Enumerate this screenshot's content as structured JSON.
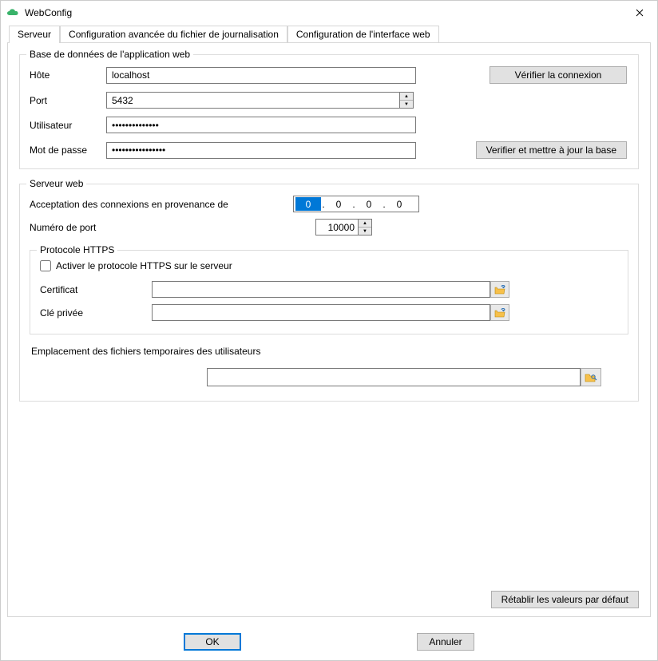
{
  "window": {
    "title": "WebConfig"
  },
  "tabs": {
    "server": "Serveur",
    "logging": "Configuration avancée du fichier de journalisation",
    "webui": "Configuration de l'interface web"
  },
  "db": {
    "legend": "Base de données de l'application web",
    "host_label": "Hôte",
    "host_value": "localhost",
    "port_label": "Port",
    "port_value": "5432",
    "user_label": "Utilisateur",
    "user_value": "••••••••••••••",
    "password_label": "Mot de passe",
    "password_value": "••••••••••••••••",
    "verify_connection": "Vérifier la connexion",
    "verify_update_db": "Verifier et mettre à jour la base"
  },
  "webserver": {
    "legend": "Serveur web",
    "accept_label": "Acceptation des connexions en provenance de",
    "ip_octets": [
      "0",
      "0",
      "0",
      "0"
    ],
    "port_label": "Numéro de port",
    "port_value": "10000"
  },
  "https": {
    "legend": "Protocole HTTPS",
    "enable_label": "Activer le protocole HTTPS sur le serveur",
    "enabled": false,
    "cert_label": "Certificat",
    "cert_value": "",
    "key_label": "Clé privée",
    "key_value": ""
  },
  "temp": {
    "label": "Emplacement des fichiers temporaires des utilisateurs",
    "value": ""
  },
  "buttons": {
    "restore_defaults": "Rétablir les valeurs par défaut",
    "ok": "OK",
    "cancel": "Annuler"
  }
}
